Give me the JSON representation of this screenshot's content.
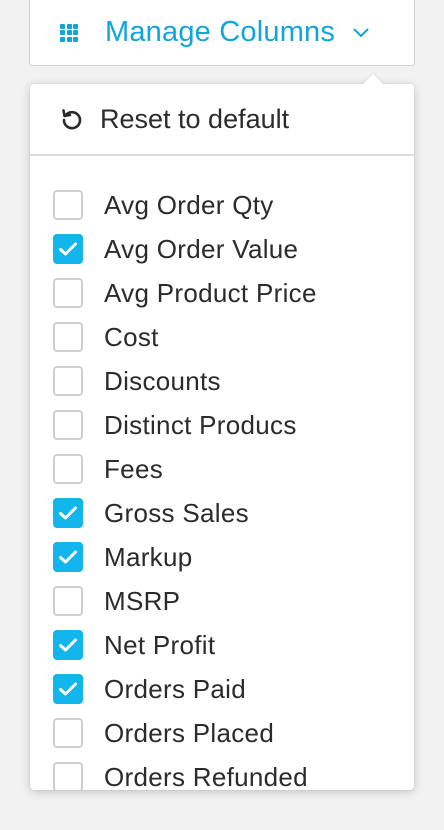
{
  "manage_button": {
    "label": "Manage Columns",
    "icon": "grid-icon",
    "chevron": "chevron-down-icon"
  },
  "menu": {
    "reset": {
      "label": "Reset to default",
      "icon": "reset-icon"
    },
    "columns": [
      {
        "label": "Avg Order Qty",
        "checked": false
      },
      {
        "label": "Avg Order Value",
        "checked": true
      },
      {
        "label": "Avg Product Price",
        "checked": false
      },
      {
        "label": "Cost",
        "checked": false
      },
      {
        "label": "Discounts",
        "checked": false
      },
      {
        "label": "Distinct Producs",
        "checked": false
      },
      {
        "label": "Fees",
        "checked": false
      },
      {
        "label": "Gross Sales",
        "checked": true
      },
      {
        "label": "Markup",
        "checked": true
      },
      {
        "label": "MSRP",
        "checked": false
      },
      {
        "label": "Net Profit",
        "checked": true
      },
      {
        "label": "Orders Paid",
        "checked": true
      },
      {
        "label": "Orders Placed",
        "checked": false
      },
      {
        "label": "Orders Refunded",
        "checked": false
      }
    ]
  },
  "colors": {
    "accent": "#12a5dc",
    "checkbox_checked": "#12b6ec",
    "text": "#2b2b2b"
  }
}
